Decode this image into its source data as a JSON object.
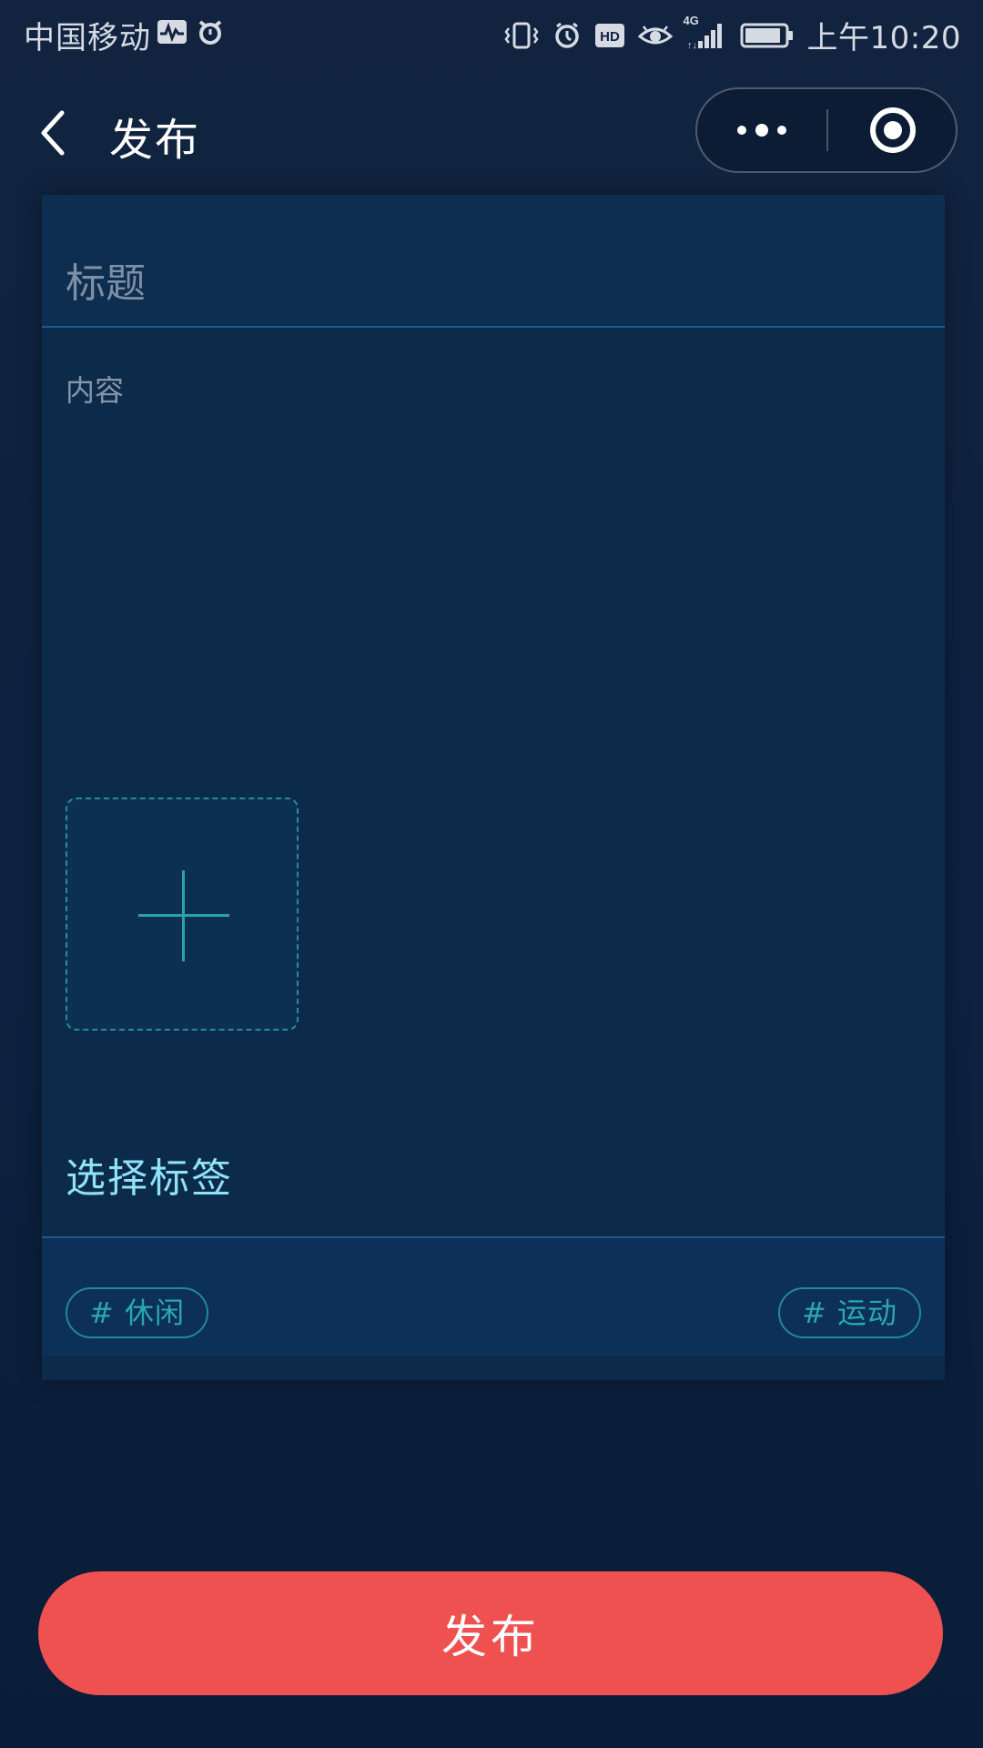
{
  "status_bar": {
    "carrier": "中国移动",
    "network": "4G",
    "time": "上午10:20",
    "icons": [
      "activity-icon",
      "alarm-clock-icon",
      "vibrate-icon",
      "clock-icon",
      "hd-icon",
      "eye-icon",
      "signal-icon",
      "battery-icon"
    ]
  },
  "nav": {
    "title": "发布"
  },
  "form": {
    "title_placeholder": "标题",
    "content_placeholder": "内容"
  },
  "tags": {
    "heading": "选择标签",
    "items": [
      "# 休闲",
      "# 运动"
    ]
  },
  "actions": {
    "publish_label": "发布"
  },
  "colors": {
    "background": "#0d1f39",
    "card": "#0c2b4b",
    "accent": "#8fe3f6",
    "tag": "#2aa6b4",
    "publish_button": "#ef5050"
  }
}
